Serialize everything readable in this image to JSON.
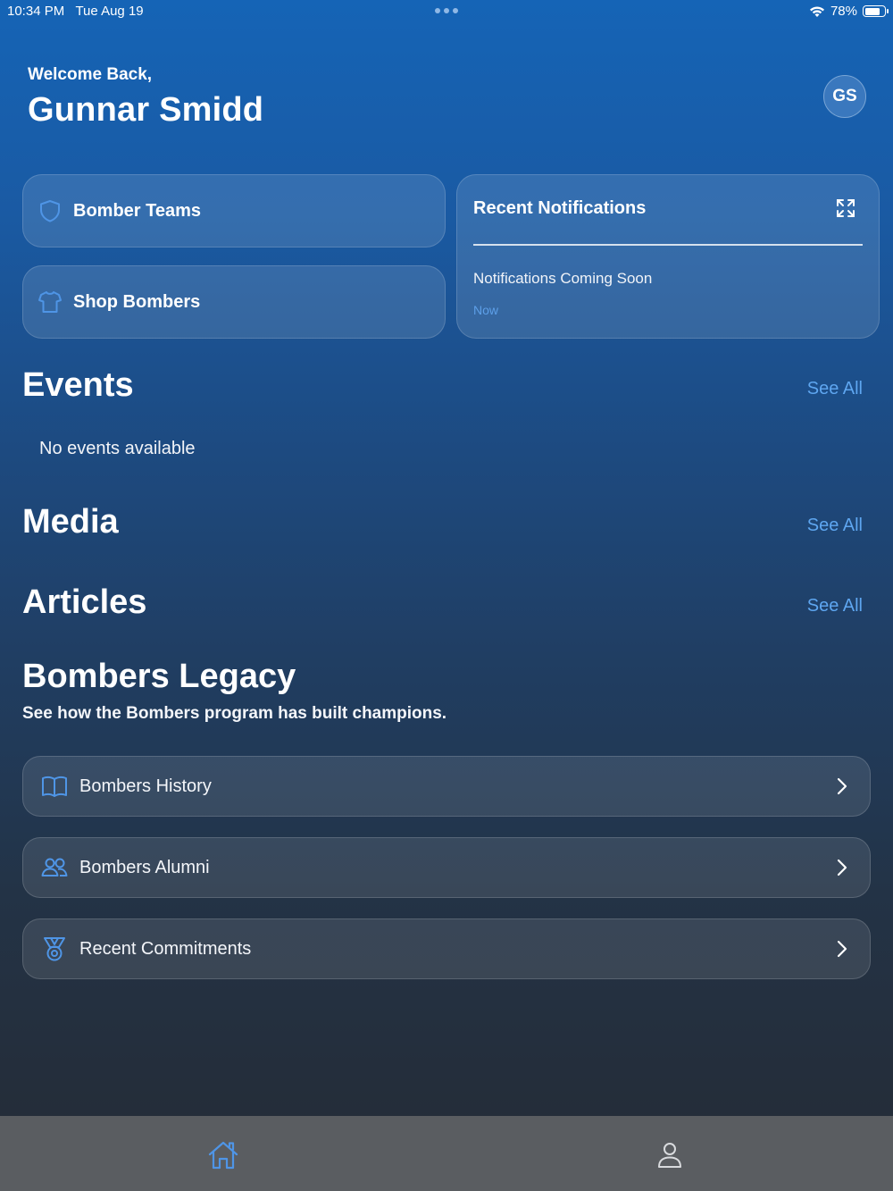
{
  "status_bar": {
    "time": "10:34 PM",
    "date": "Tue Aug 19",
    "battery": "78%",
    "battery_level": 0.78
  },
  "header": {
    "greeting": "Welcome Back,",
    "user_name": "Gunnar Smidd",
    "avatar_initials": "GS"
  },
  "quick_links": {
    "teams_label": "Bomber Teams",
    "shop_label": "Shop Bombers"
  },
  "notifications": {
    "title": "Recent Notifications",
    "item_text": "Notifications Coming Soon",
    "item_time": "Now"
  },
  "events": {
    "title": "Events",
    "see_all": "See All",
    "empty_text": "No events available"
  },
  "media": {
    "title": "Media",
    "see_all": "See All"
  },
  "articles": {
    "title": "Articles",
    "see_all": "See All"
  },
  "legacy": {
    "title": "Bombers Legacy",
    "subtitle": "See how the Bombers program has built champions.",
    "items": [
      {
        "label": "Bombers History",
        "icon": "book-icon"
      },
      {
        "label": "Bombers Alumni",
        "icon": "people-icon"
      },
      {
        "label": "Recent Commitments",
        "icon": "medal-icon"
      }
    ]
  },
  "tab_bar": {
    "tabs": [
      {
        "icon": "home-icon",
        "selected": true
      },
      {
        "icon": "person-icon",
        "selected": false
      }
    ]
  },
  "colors": {
    "accent": "#5ea6f0",
    "icon_blue": "#4f95e6",
    "tab_bar_bg": "#5a5d61"
  }
}
